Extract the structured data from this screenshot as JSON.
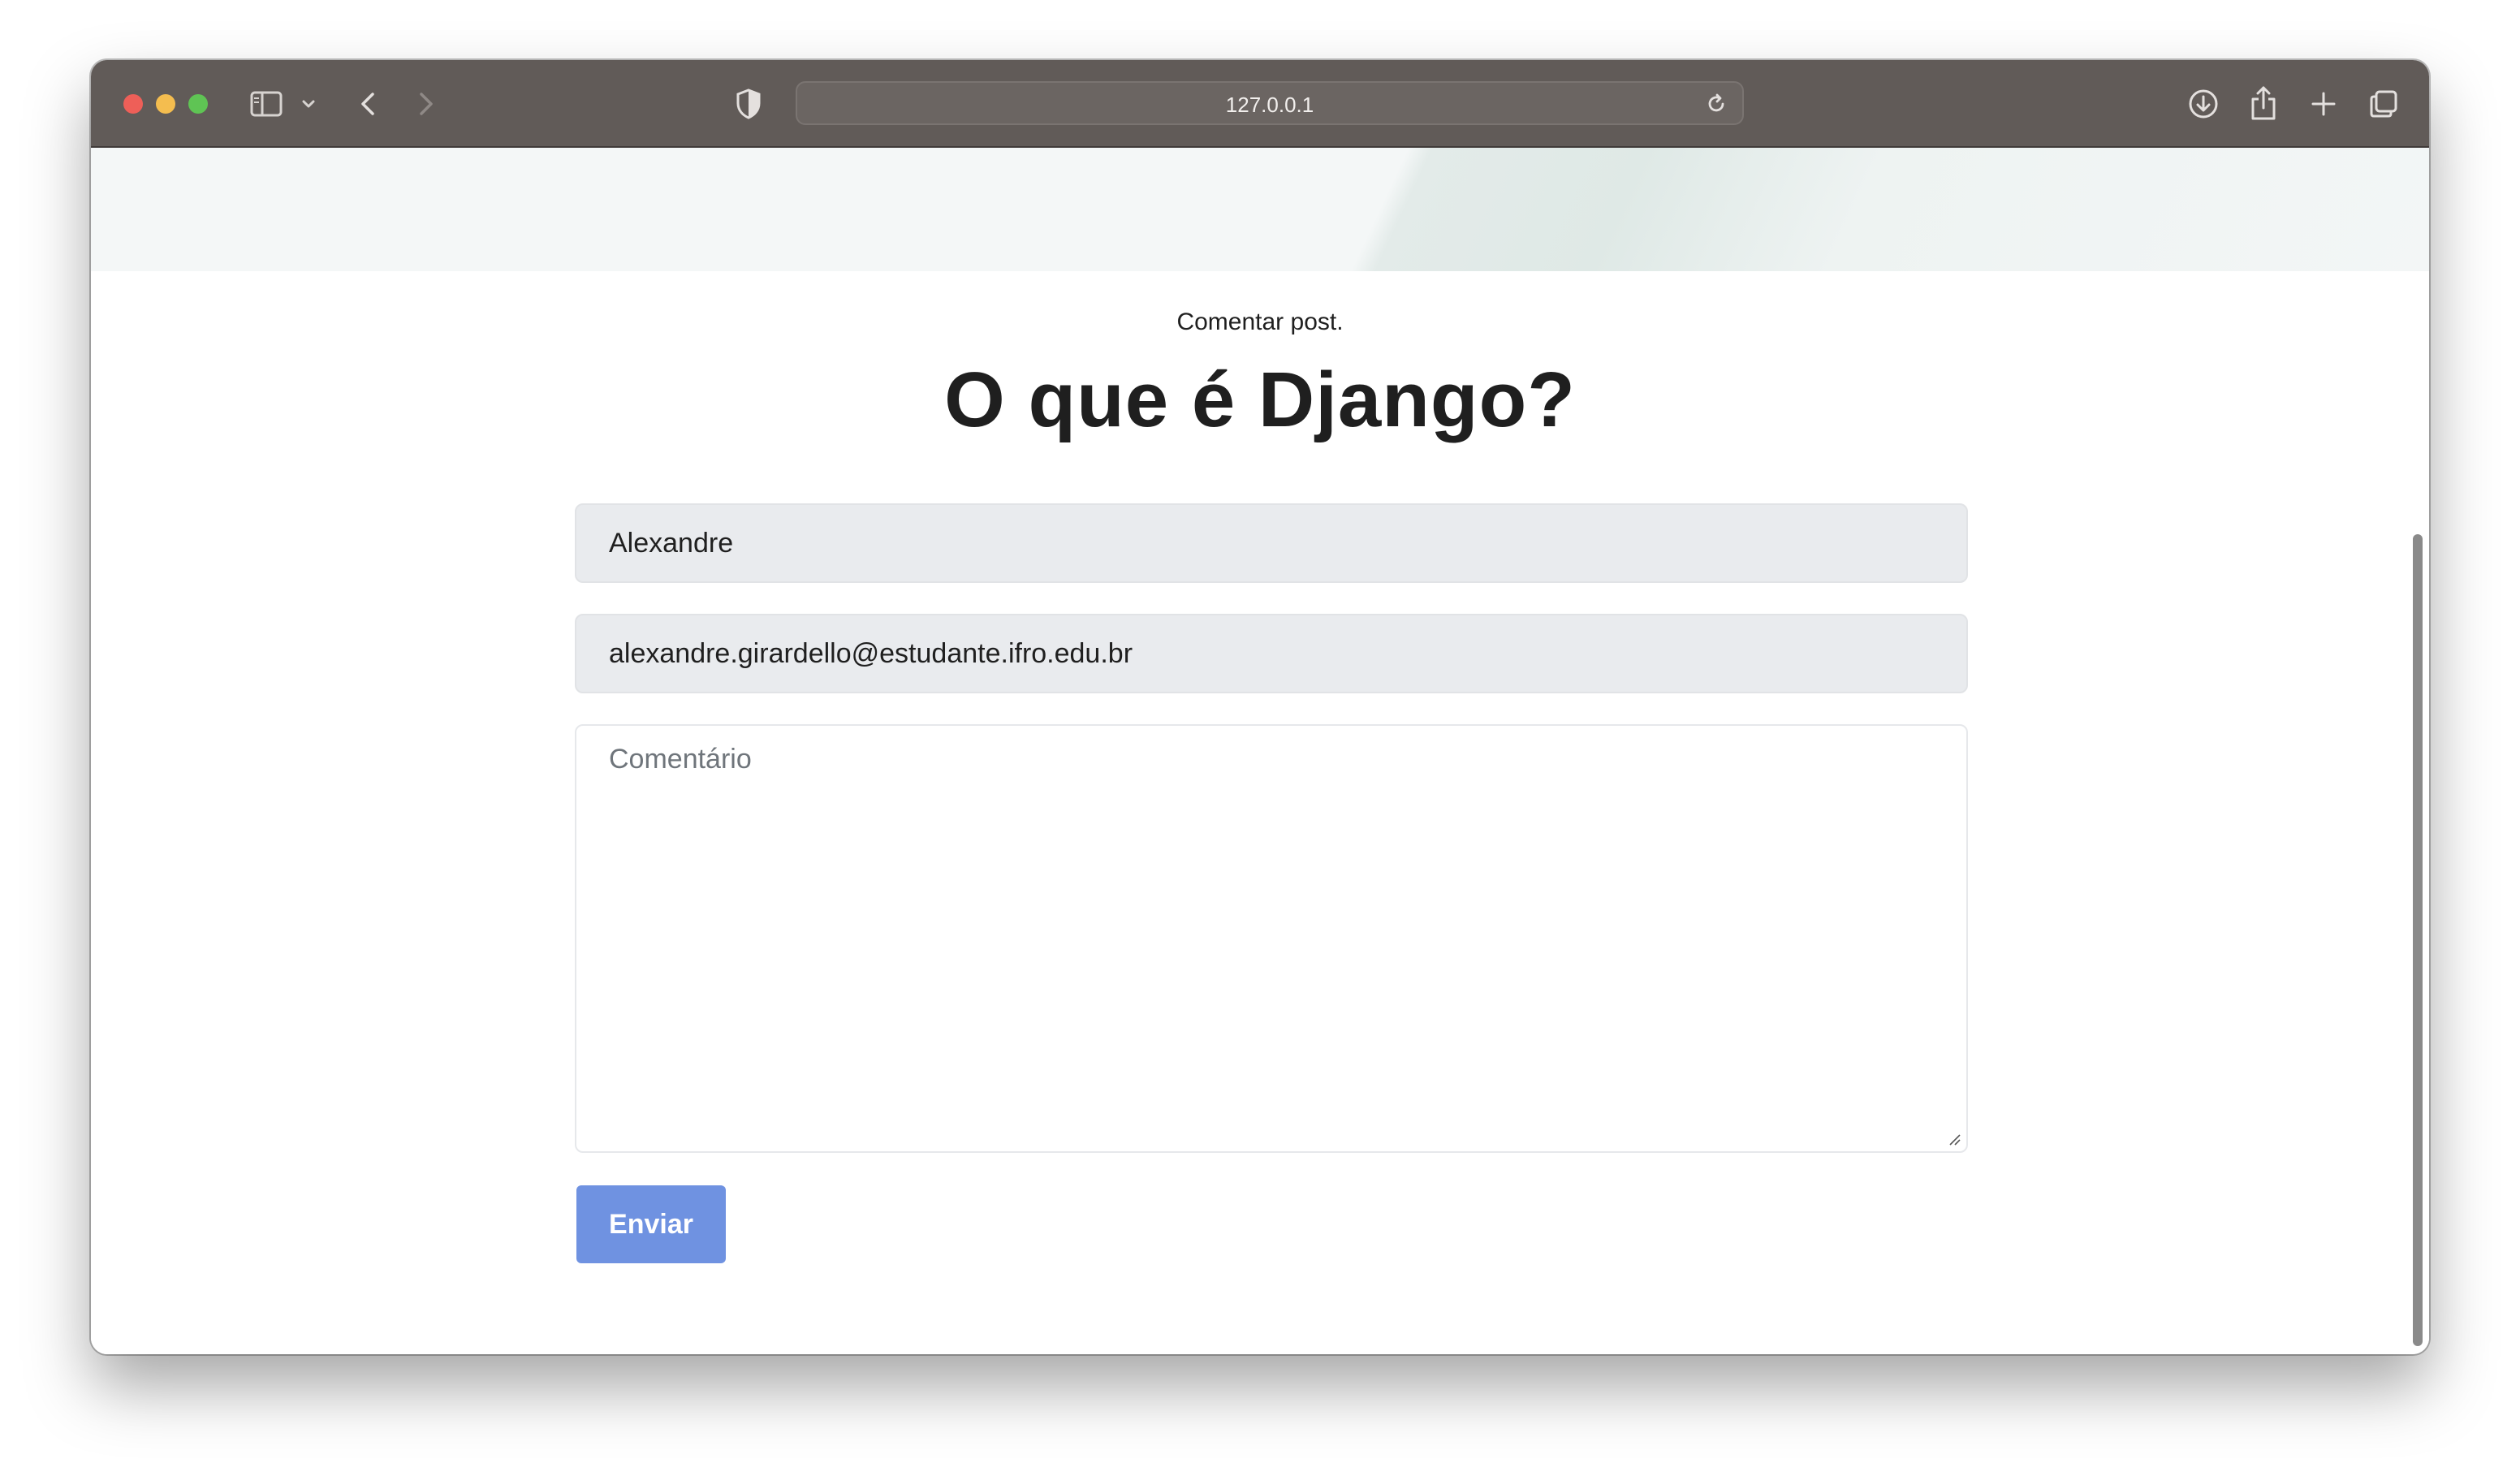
{
  "browser": {
    "address": "127.0.0.1",
    "icons": {
      "sidebar": "sidebar-icon",
      "sidebar_menu": "chevron-down-icon",
      "back": "chevron-left-icon",
      "forward": "chevron-right-icon",
      "privacy": "shield-icon",
      "reload": "reload-icon",
      "download": "download-icon",
      "share": "share-icon",
      "new_tab": "plus-icon",
      "tab_overview": "tabs-icon"
    }
  },
  "page": {
    "subtitle": "Comentar post.",
    "title": "O que é Django?"
  },
  "form": {
    "name_value": "Alexandre",
    "email_value": "alexandre.girardello@estudante.ifro.edu.br",
    "comment_placeholder": "Comentário",
    "submit_label": "Enviar"
  },
  "colors": {
    "toolbar": "#615b58",
    "input_background": "#e9ebee",
    "submit_button": "#6f92e1"
  }
}
